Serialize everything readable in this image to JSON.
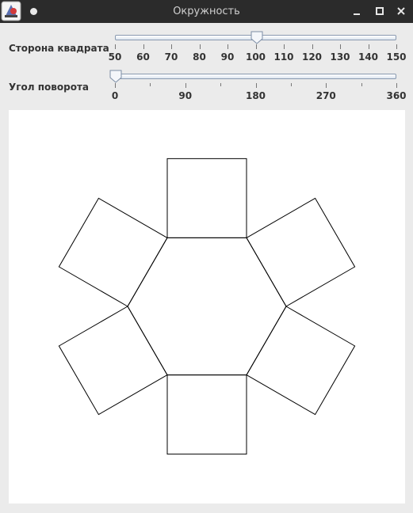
{
  "window": {
    "title": "Окружность",
    "icons": {
      "app": "java-app-icon",
      "menu": "window-menu-dot-icon",
      "minimize": "minimize-icon",
      "maximize": "maximize-icon",
      "close": "close-icon"
    }
  },
  "controls": {
    "side": {
      "label": "Сторона квадрата",
      "min": 50,
      "max": 150,
      "value": 100,
      "major_ticks": [
        "50",
        "60",
        "70",
        "80",
        "90",
        "100",
        "110",
        "120",
        "130",
        "140",
        "150"
      ]
    },
    "angle": {
      "label": "Угол поворота",
      "min": 0,
      "max": 360,
      "value": 0,
      "major_ticks": [
        "0",
        "90",
        "180",
        "270",
        "360"
      ]
    }
  },
  "drawing": {
    "shape": "hexagon with a square on each side",
    "hexagon_sides": 6,
    "stroke_color": "#000000",
    "background": "#ffffff"
  },
  "colors": {
    "titlebar": "#2b2b2b",
    "window_bg": "#ebebeb"
  }
}
